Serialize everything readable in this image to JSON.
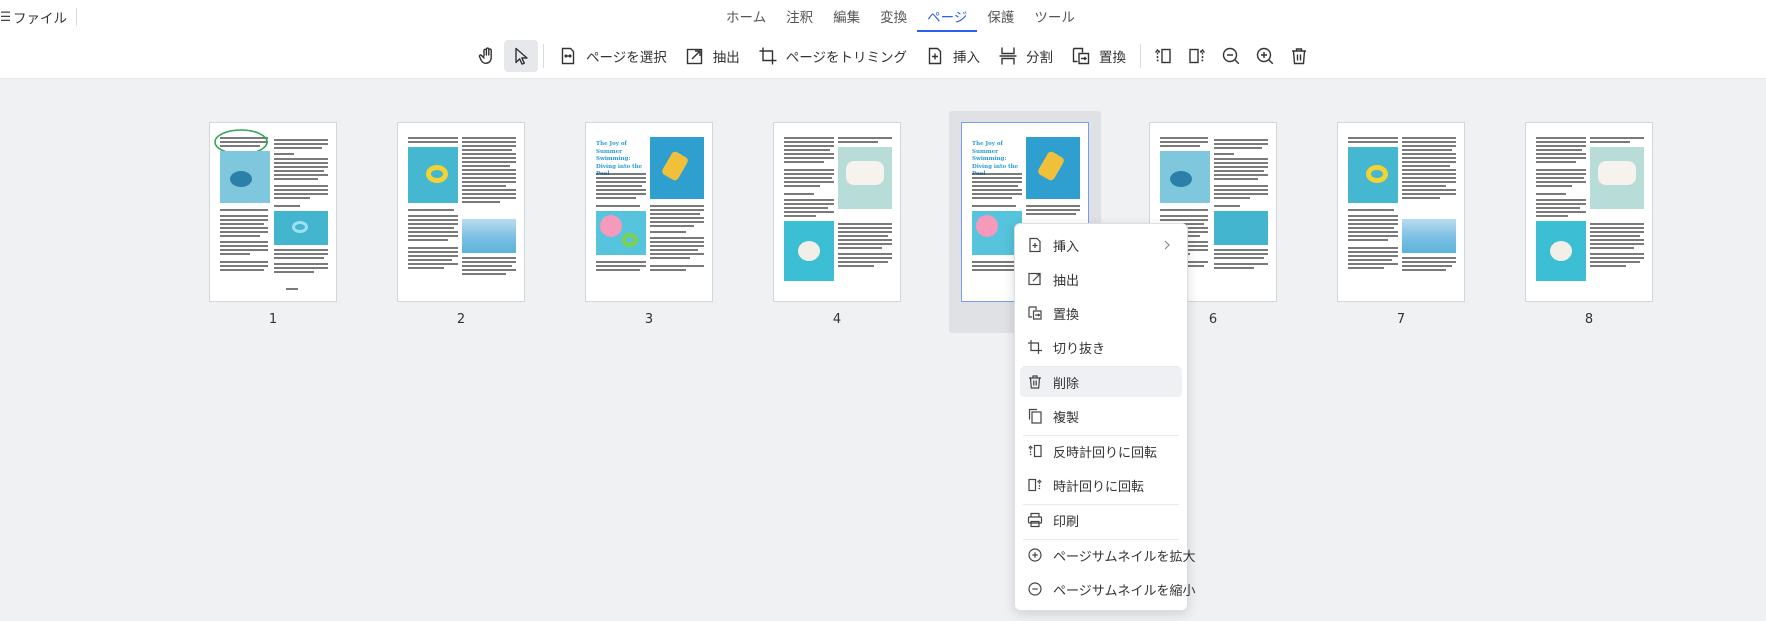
{
  "header": {
    "file_label": "ファイル",
    "tabs": [
      {
        "label": "ホーム"
      },
      {
        "label": "注釈"
      },
      {
        "label": "編集"
      },
      {
        "label": "変換"
      },
      {
        "label": "ページ",
        "active": true
      },
      {
        "label": "保護"
      },
      {
        "label": "ツール"
      }
    ]
  },
  "toolbar": {
    "select_pages": "ページを選択",
    "extract": "抽出",
    "trim_pages": "ページをトリミング",
    "insert": "挿入",
    "split": "分割",
    "replace": "置換"
  },
  "pages": [
    {
      "number": "1"
    },
    {
      "number": "2"
    },
    {
      "number": "3",
      "title": "The Joy of Summer Swimming: Diving into the Pool"
    },
    {
      "number": "4"
    },
    {
      "number": "5",
      "title": "The Joy of Summer Swimming: Diving into the Pool",
      "selected": true
    },
    {
      "number": "6"
    },
    {
      "number": "7"
    },
    {
      "number": "8"
    }
  ],
  "context_menu": {
    "insert": "挿入",
    "extract": "抽出",
    "replace": "置換",
    "crop": "切り抜き",
    "delete": "削除",
    "duplicate": "複製",
    "rotate_ccw": "反時計回りに回転",
    "rotate_cw": "時計回りに回転",
    "print": "印刷",
    "enlarge_thumbnails": "ページサムネイルを拡大",
    "shrink_thumbnails": "ページサムネイルを縮小"
  },
  "colors": {
    "accent": "#2b5ff0",
    "pool_blue": "#3fb6d6",
    "annotation_green": "#2fa84f"
  }
}
